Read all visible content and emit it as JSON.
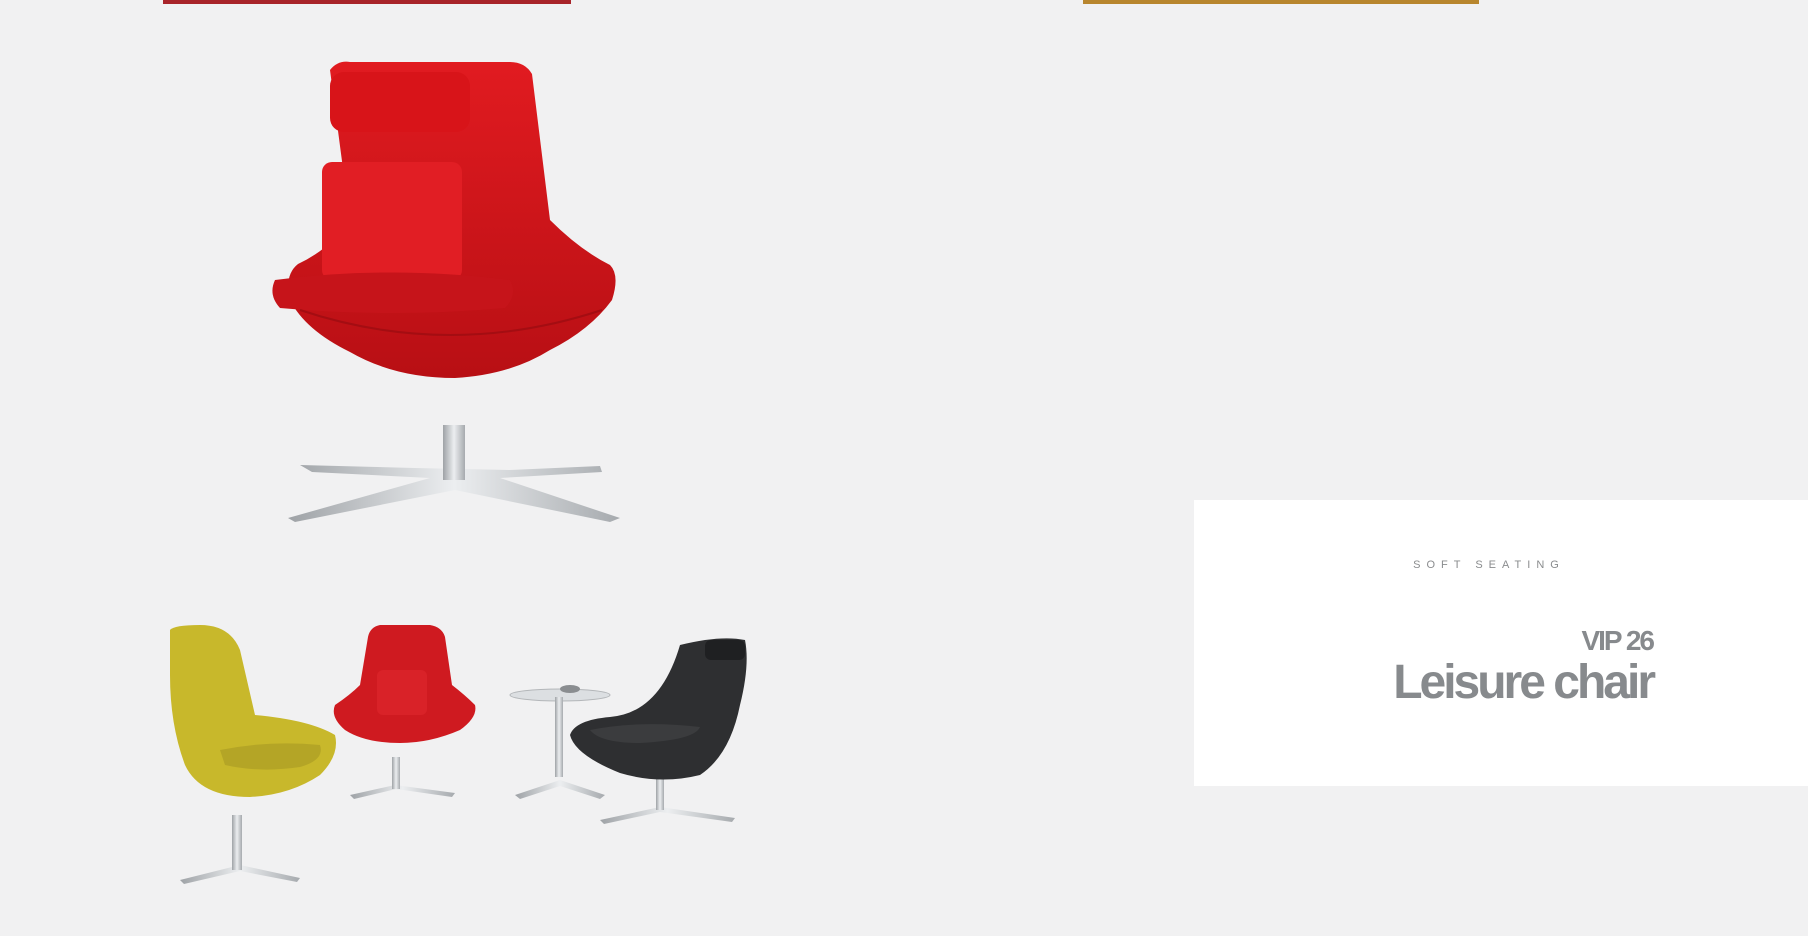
{
  "card": {
    "category": "SOFT SEATING",
    "model": "VIP 26",
    "product_name": "Leisure chair"
  },
  "colors": {
    "accent_red": "#a8242a",
    "accent_gold": "#b8862e",
    "chair_red": "#d4161b",
    "chair_yellow": "#c5b52a",
    "chair_black": "#2e2f31",
    "text_gray": "#878a8d"
  },
  "images": {
    "hero": "red-leisure-chair-photo",
    "group": "three-chairs-and-side-table-photo"
  }
}
